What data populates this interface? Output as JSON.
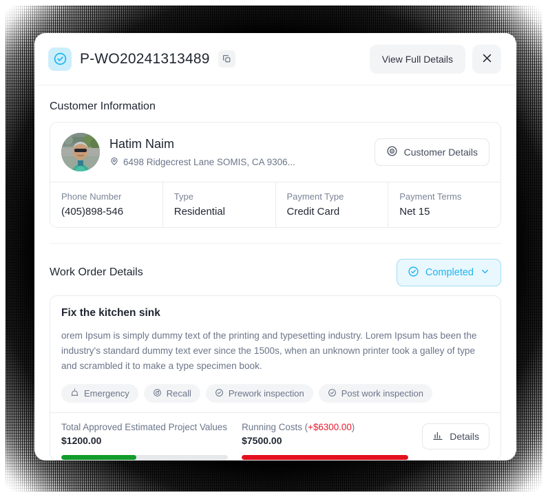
{
  "header": {
    "work_order_id": "P-WO20241313489",
    "status_icon": "check-circle-icon",
    "copy_icon": "copy-icon",
    "view_full_details_label": "View Full Details",
    "close_icon": "close-icon"
  },
  "customer_section": {
    "title": "Customer Information",
    "name": "Hatim Naim",
    "address": "6498 Ridgecrest Lane SOMIS, CA 9306...",
    "address_icon": "location-pin-icon",
    "details_button_label": "Customer Details",
    "details_button_icon": "eye-icon",
    "facts": [
      {
        "label": "Phone Number",
        "value": "(405)898-546"
      },
      {
        "label": "Type",
        "value": "Residential"
      },
      {
        "label": "Payment Type",
        "value": "Credit Card"
      },
      {
        "label": "Payment Terms",
        "value": "Net 15"
      }
    ]
  },
  "work_order_section": {
    "title": "Work Order Details",
    "status": {
      "label": "Completed",
      "icon": "check-circle-icon",
      "chevron": "chevron-down-icon",
      "color": "#20b3f0",
      "background": "#e9f8fe"
    },
    "job_title": "Fix the kitchen sink",
    "description": "orem Ipsum is simply dummy text of the printing and typesetting industry. Lorem Ipsum has been the industry's standard dummy text ever since the 1500s, when an unknown printer took a galley of type and scrambled it to make a type specimen book.",
    "tags": [
      {
        "label": "Emergency",
        "icon": "siren-icon"
      },
      {
        "label": "Recall",
        "icon": "recall-icon"
      },
      {
        "label": "Prework inspection",
        "icon": "check-circle-icon"
      },
      {
        "label": "Post work inspection",
        "icon": "check-circle-icon"
      }
    ],
    "totals": {
      "estimated": {
        "label": "Total Approved Estimated Project Values",
        "value": "$1200.00",
        "progress_percent": 45,
        "bar_color": "#119c2b"
      },
      "running": {
        "label_prefix": "Running Costs (",
        "delta": "+$6300.00",
        "label_suffix": ")",
        "value": "$7500.00",
        "progress_percent": 100,
        "bar_color": "#e3101f"
      },
      "details_button_label": "Details",
      "details_button_icon": "bar-chart-icon"
    }
  }
}
